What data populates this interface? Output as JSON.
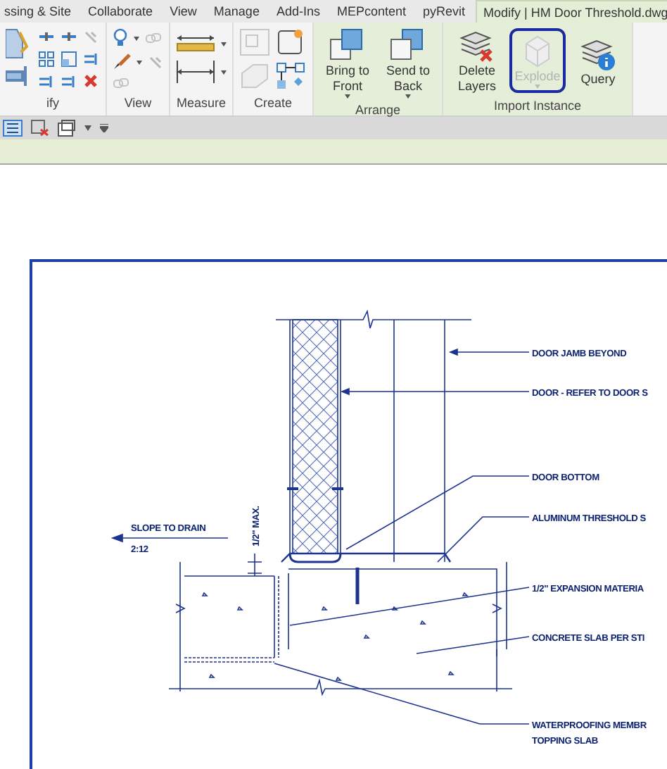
{
  "ribbon_tabs": [
    {
      "label": "ssing & Site",
      "selected": false
    },
    {
      "label": "Collaborate",
      "selected": false
    },
    {
      "label": "View",
      "selected": false
    },
    {
      "label": "Manage",
      "selected": false
    },
    {
      "label": "Add-Ins",
      "selected": false
    },
    {
      "label": "MEPcontent",
      "selected": false
    },
    {
      "label": "pyRevit",
      "selected": false
    },
    {
      "label": "Modify | HM Door Threshold.dwg",
      "selected": true
    }
  ],
  "ribbon_panels": [
    {
      "label": "ify",
      "kind": "modify",
      "contextual": false
    },
    {
      "label": "View",
      "kind": "view",
      "contextual": false
    },
    {
      "label": "Measure",
      "kind": "measure",
      "contextual": false
    },
    {
      "label": "Create",
      "kind": "create",
      "contextual": false
    },
    {
      "label": "Arrange",
      "kind": "buttons",
      "contextual": true,
      "buttons": [
        {
          "label": "Bring to Front",
          "dropdown": true,
          "disabled": false,
          "circled": false
        },
        {
          "label": "Send to Back",
          "dropdown": true,
          "disabled": false,
          "circled": false
        }
      ]
    },
    {
      "label": "Import Instance",
      "kind": "buttons",
      "contextual": true,
      "buttons": [
        {
          "label": "Delete Layers",
          "dropdown": false,
          "disabled": false,
          "circled": false
        },
        {
          "label": "Explode",
          "dropdown": true,
          "disabled": true,
          "circled": true
        },
        {
          "label": "Query",
          "dropdown": false,
          "disabled": false,
          "circled": false
        }
      ]
    }
  ],
  "detail": {
    "notes": [
      {
        "lines": [
          "DOOR JAMB BEYOND"
        ]
      },
      {
        "lines": [
          "DOOR - REFER TO DOOR S"
        ]
      },
      {
        "lines": [
          "DOOR BOTTOM"
        ]
      },
      {
        "lines": [
          "ALUMINUM THRESHOLD S"
        ]
      },
      {
        "lines": [
          "1/2\" EXPANSION MATERIA"
        ]
      },
      {
        "lines": [
          "CONCRETE SLAB PER STI"
        ]
      },
      {
        "lines": [
          "WATERPROOFING MEMBR",
          "TOPPING SLAB"
        ]
      }
    ],
    "slope": {
      "label": "SLOPE TO DRAIN",
      "ratio": "2:12"
    },
    "dimension": "1/2\" MAX."
  }
}
